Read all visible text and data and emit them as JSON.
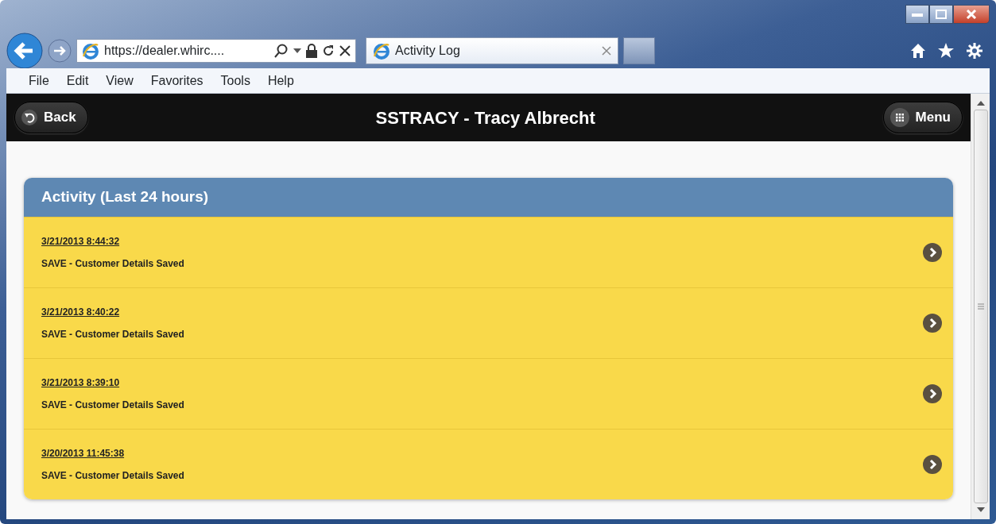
{
  "browser": {
    "address": "https://dealer.whirc....",
    "tabs": [
      {
        "label": "Activity Log",
        "selected": true
      }
    ],
    "menu": [
      "File",
      "Edit",
      "View",
      "Favorites",
      "Tools",
      "Help"
    ]
  },
  "header": {
    "back": "Back",
    "title": "SSTRACY - Tracy Albrecht",
    "menu": "Menu"
  },
  "activity": {
    "title": "Activity (Last 24 hours)",
    "items": [
      {
        "time": "3/21/2013 8:44:32",
        "description": "SAVE - Customer Details Saved"
      },
      {
        "time": "3/21/2013 8:40:22",
        "description": "SAVE - Customer Details Saved"
      },
      {
        "time": "3/21/2013 8:39:10",
        "description": "SAVE - Customer Details Saved"
      },
      {
        "time": "3/20/2013 11:45:38",
        "description": "SAVE - Customer Details Saved"
      }
    ]
  }
}
